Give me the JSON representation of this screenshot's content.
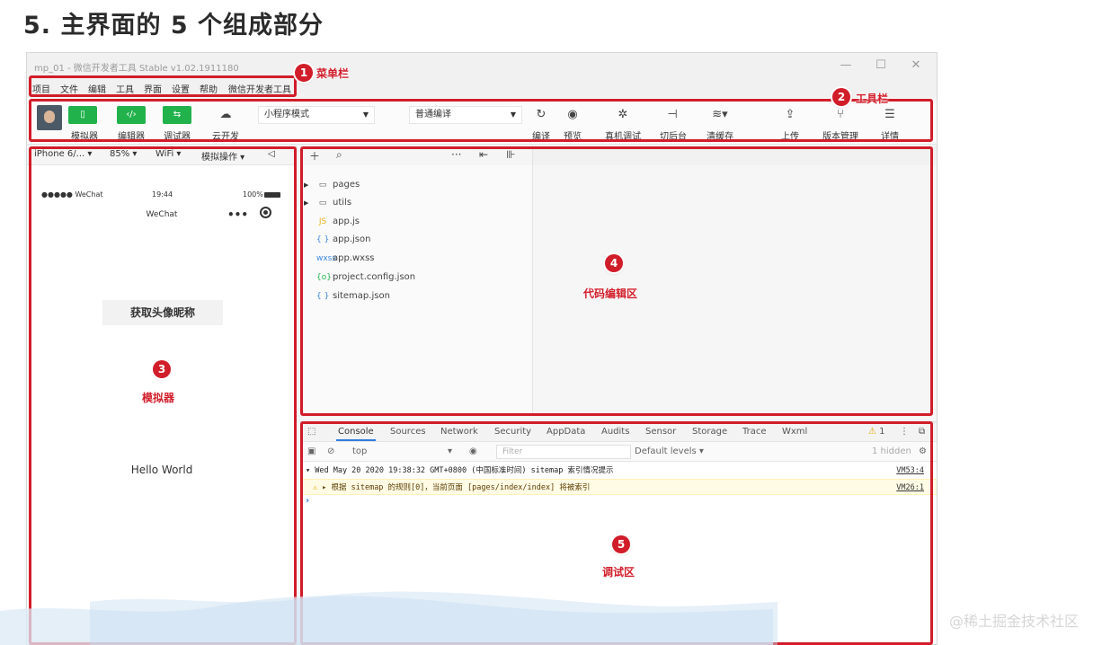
{
  "slide": {
    "title": "5. 主界面的 5 个组成部分"
  },
  "window": {
    "title": "mp_01 - 微信开发者工具 Stable v1.02.1911180",
    "controls": {
      "minimize": "—",
      "maximize": "☐",
      "close": "✕"
    }
  },
  "menu": [
    "项目",
    "文件",
    "编辑",
    "工具",
    "界面",
    "设置",
    "帮助",
    "微信开发者工具"
  ],
  "toolbar": {
    "simulator_label": "模拟器",
    "editor_label": "编辑器",
    "debugger_label": "调试器",
    "cloud_label": "云开发",
    "mode_value": "小程序模式",
    "compile_mode_value": "普通编译",
    "compile_label": "编译",
    "preview_label": "预览",
    "remote_debug_label": "真机调试",
    "background_label": "切后台",
    "clear_cache_label": "清缓存",
    "upload_label": "上传",
    "version_label": "版本管理",
    "details_label": "详情"
  },
  "simulator": {
    "device": "iPhone 6/...",
    "zoom": "85%",
    "network": "WiFi",
    "operation": "模拟操作",
    "status_left": "●●●●● WeChat",
    "status_time": "19:44",
    "status_battery": "100%",
    "nav_title": "WeChat",
    "get_profile_button": "获取头像昵称",
    "hello_text": "Hello World"
  },
  "explorer": {
    "files": [
      {
        "name": "pages",
        "type": "folder"
      },
      {
        "name": "utils",
        "type": "folder"
      },
      {
        "name": "app.js",
        "type": "js"
      },
      {
        "name": "app.json",
        "type": "json"
      },
      {
        "name": "app.wxss",
        "type": "wxss"
      },
      {
        "name": "project.config.json",
        "type": "config"
      },
      {
        "name": "sitemap.json",
        "type": "json"
      }
    ]
  },
  "devtools": {
    "tabs": [
      "Console",
      "Sources",
      "Network",
      "Security",
      "AppData",
      "Audits",
      "Sensor",
      "Storage",
      "Trace",
      "Wxml"
    ],
    "active_tab": "Console",
    "warn_count": "1",
    "context": "top",
    "filter_placeholder": "Filter",
    "levels": "Default levels ▾",
    "hidden": "1 hidden",
    "log1": "▾ Wed May 20 2020 19:38:32 GMT+0800 (中国标准时间) sitemap 索引情况提示",
    "log1_ref": "VM53:4",
    "log2": "▸ 根据 sitemap 的规则[0]，当前页面 [pages/index/index] 将被索引",
    "log2_ref": "VM26:1",
    "prompt": "›"
  },
  "annotations": [
    {
      "number": "1",
      "label": "菜单栏"
    },
    {
      "number": "2",
      "label": "工具栏"
    },
    {
      "number": "3",
      "label": "模拟器"
    },
    {
      "number": "4",
      "label": "代码编辑区"
    },
    {
      "number": "5",
      "label": "调试区"
    }
  ],
  "watermark": "@稀土掘金技术社区",
  "colors": {
    "annotation_red": "#d11d2a",
    "wechat_green": "#22b24c",
    "devtools_blue": "#2e7de0"
  }
}
